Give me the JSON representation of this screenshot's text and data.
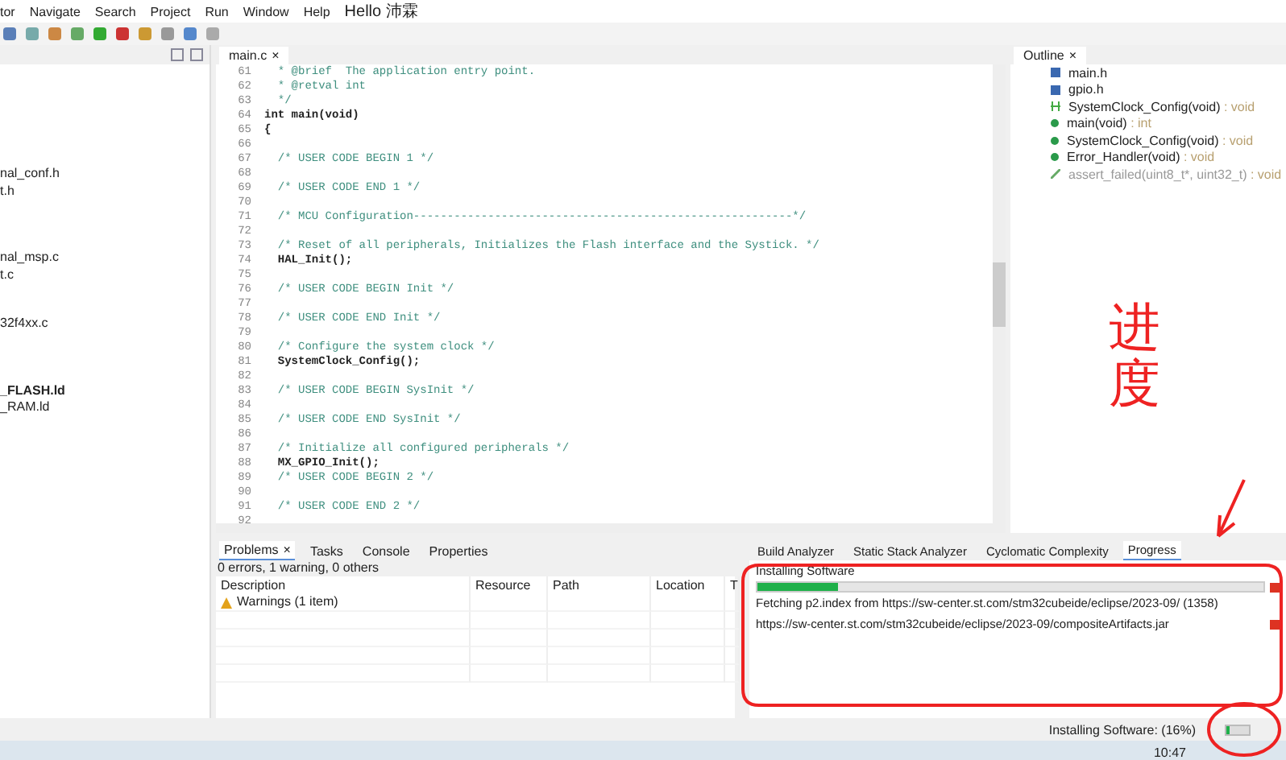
{
  "menu": [
    "tor",
    "Navigate",
    "Search",
    "Project",
    "Run",
    "Window",
    "Help"
  ],
  "user": "Hello 沛霖",
  "explorer": {
    "items": [
      {
        "label": "nal_conf.h",
        "bold": false
      },
      {
        "label": "t.h",
        "bold": false
      },
      {
        "label": "nal_msp.c",
        "bold": false
      },
      {
        "label": "t.c",
        "bold": false
      },
      {
        "label": "32f4xx.c",
        "bold": false
      },
      {
        "label": "_FLASH.ld",
        "bold": true
      },
      {
        "label": "_RAM.ld",
        "bold": false
      }
    ]
  },
  "editor": {
    "tab": "main.c",
    "close": "×",
    "lines": [
      {
        "number": "61",
        "kind": "comment",
        "text": "  * @brief  The application entry point."
      },
      {
        "number": "62",
        "kind": "comment",
        "text": "  * @retval int"
      },
      {
        "number": "63",
        "kind": "comment",
        "text": "  */"
      },
      {
        "number": "64",
        "kind": "code",
        "text": "int main(void)"
      },
      {
        "number": "65",
        "kind": "code",
        "text": "{"
      },
      {
        "number": "66",
        "kind": "blank"
      },
      {
        "number": "67",
        "kind": "comment",
        "text": "  /* USER CODE BEGIN 1 */"
      },
      {
        "number": "68",
        "kind": "blank"
      },
      {
        "number": "69",
        "kind": "comment",
        "text": "  /* USER CODE END 1 */"
      },
      {
        "number": "70",
        "kind": "blank"
      },
      {
        "number": "71",
        "kind": "comment",
        "text": "  /* MCU Configuration--------------------------------------------------------*/"
      },
      {
        "number": "72",
        "kind": "blank"
      },
      {
        "number": "73",
        "kind": "comment",
        "text": "  /* Reset of all peripherals, Initializes the Flash interface and the Systick. */"
      },
      {
        "number": "74",
        "kind": "code",
        "text": "  HAL_Init();"
      },
      {
        "number": "75",
        "kind": "blank"
      },
      {
        "number": "76",
        "kind": "comment",
        "text": "  /* USER CODE BEGIN Init */"
      },
      {
        "number": "77",
        "kind": "blank"
      },
      {
        "number": "78",
        "kind": "comment",
        "text": "  /* USER CODE END Init */"
      },
      {
        "number": "79",
        "kind": "blank"
      },
      {
        "number": "80",
        "kind": "comment",
        "text": "  /* Configure the system clock */"
      },
      {
        "number": "81",
        "kind": "code",
        "text": "  SystemClock_Config();"
      },
      {
        "number": "82",
        "kind": "blank"
      },
      {
        "number": "83",
        "kind": "comment",
        "text": "  /* USER CODE BEGIN SysInit */"
      },
      {
        "number": "84",
        "kind": "blank"
      },
      {
        "number": "85",
        "kind": "comment",
        "text": "  /* USER CODE END SysInit */"
      },
      {
        "number": "86",
        "kind": "blank"
      },
      {
        "number": "87",
        "kind": "comment",
        "text": "  /* Initialize all configured peripherals */"
      },
      {
        "number": "88",
        "kind": "code",
        "text": "  MX_GPIO_Init();"
      },
      {
        "number": "89",
        "kind": "comment",
        "text": "  /* USER CODE BEGIN 2 */"
      },
      {
        "number": "90",
        "kind": "blank"
      },
      {
        "number": "91",
        "kind": "comment",
        "text": "  /* USER CODE END 2 */"
      },
      {
        "number": "92",
        "kind": "blank"
      }
    ]
  },
  "outline": {
    "title": "Outline",
    "close": "×",
    "items": [
      {
        "kind": "include",
        "name": "main.h"
      },
      {
        "kind": "include",
        "name": "gpio.h"
      },
      {
        "kind": "prototype",
        "name": "SystemClock_Config(void)",
        "type": " : void"
      },
      {
        "kind": "function",
        "name": "main(void)",
        "type": " : int"
      },
      {
        "kind": "function",
        "name": "SystemClock_Config(void)",
        "type": " : void"
      },
      {
        "kind": "function",
        "name": "Error_Handler(void)",
        "type": " : void"
      },
      {
        "kind": "disabled",
        "name": "assert_failed(uint8_t*, uint32_t)",
        "type": " : void"
      }
    ]
  },
  "problems": {
    "close": "×",
    "tabs": [
      {
        "label": "Problems",
        "selected": true
      },
      {
        "label": "Tasks",
        "selected": false
      },
      {
        "label": "Console",
        "selected": false
      },
      {
        "label": "Properties",
        "selected": false
      }
    ],
    "summary": "0 errors, 1 warning, 0 others",
    "columns": [
      "Description",
      "Resource",
      "Path",
      "Location",
      "T"
    ],
    "rows": [
      {
        "description": "Warnings (1 item)"
      }
    ]
  },
  "progress": {
    "tabs": [
      {
        "label": "Build Analyzer",
        "selected": false
      },
      {
        "label": "Static Stack Analyzer",
        "selected": false
      },
      {
        "label": "Cyclomatic Complexity",
        "selected": false
      },
      {
        "label": "Progress",
        "selected": true
      }
    ],
    "jobs": [
      {
        "kind": "bar",
        "title": "Installing Software",
        "level": 0.16,
        "detail": "Fetching p2.index from https://sw-center.st.com/stm32cubeide/eclipse/2023-09/ (1358)"
      },
      {
        "kind": "plain",
        "title": "https://sw-center.st.com/stm32cubeide/eclipse/2023-09/compositeArtifacts.jar"
      }
    ]
  },
  "status_bar": {
    "text": "Installing Software: (16%)",
    "level": 0.16
  },
  "taskbar": {
    "time": "10:47"
  },
  "annotation": {
    "text": "进度"
  }
}
